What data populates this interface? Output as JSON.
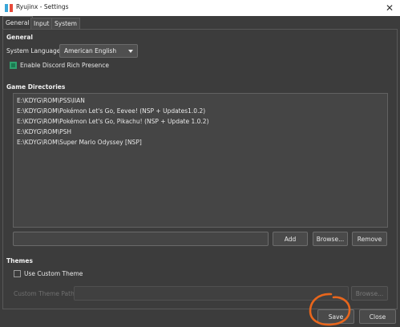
{
  "window": {
    "title": "Ryujinx - Settings",
    "close_glyph": "✕"
  },
  "tabs": [
    {
      "label": "General",
      "active": true
    },
    {
      "label": "Input",
      "active": false
    },
    {
      "label": "System",
      "active": false
    }
  ],
  "general": {
    "section_title": "General",
    "language_label": "System Language:",
    "language_value": "American English",
    "discord_label": "Enable Discord Rich Presence",
    "discord_checked": true
  },
  "game_directories": {
    "section_title": "Game Directories",
    "items": [
      "E:\\KDYG\\ROM\\PSS\\IIAN",
      "E:\\KDYG\\ROM\\Pokémon Let's Go, Eevee! (NSP + Updates1.0.2)",
      "E:\\KDYG\\ROM\\Pokémon Let's Go, Pikachu! (NSP + Update 1.0.2)",
      "E:\\KDYG\\ROM\\PSH",
      "E:\\KDYG\\ROM\\Super Mario Odyssey [NSP]"
    ],
    "path_input_value": "",
    "add_label": "Add",
    "browse_label": "Browse...",
    "remove_label": "Remove"
  },
  "themes": {
    "section_title": "Themes",
    "custom_theme_label": "Use Custom Theme",
    "custom_theme_checked": false,
    "custom_theme_path_placeholder": "Custom Theme Path:",
    "browse_label": "Browse..."
  },
  "footer": {
    "save_label": "Save",
    "close_label": "Close"
  },
  "colors": {
    "annotation_circle": "#e8661c",
    "accent_check": "#2fa06e"
  }
}
